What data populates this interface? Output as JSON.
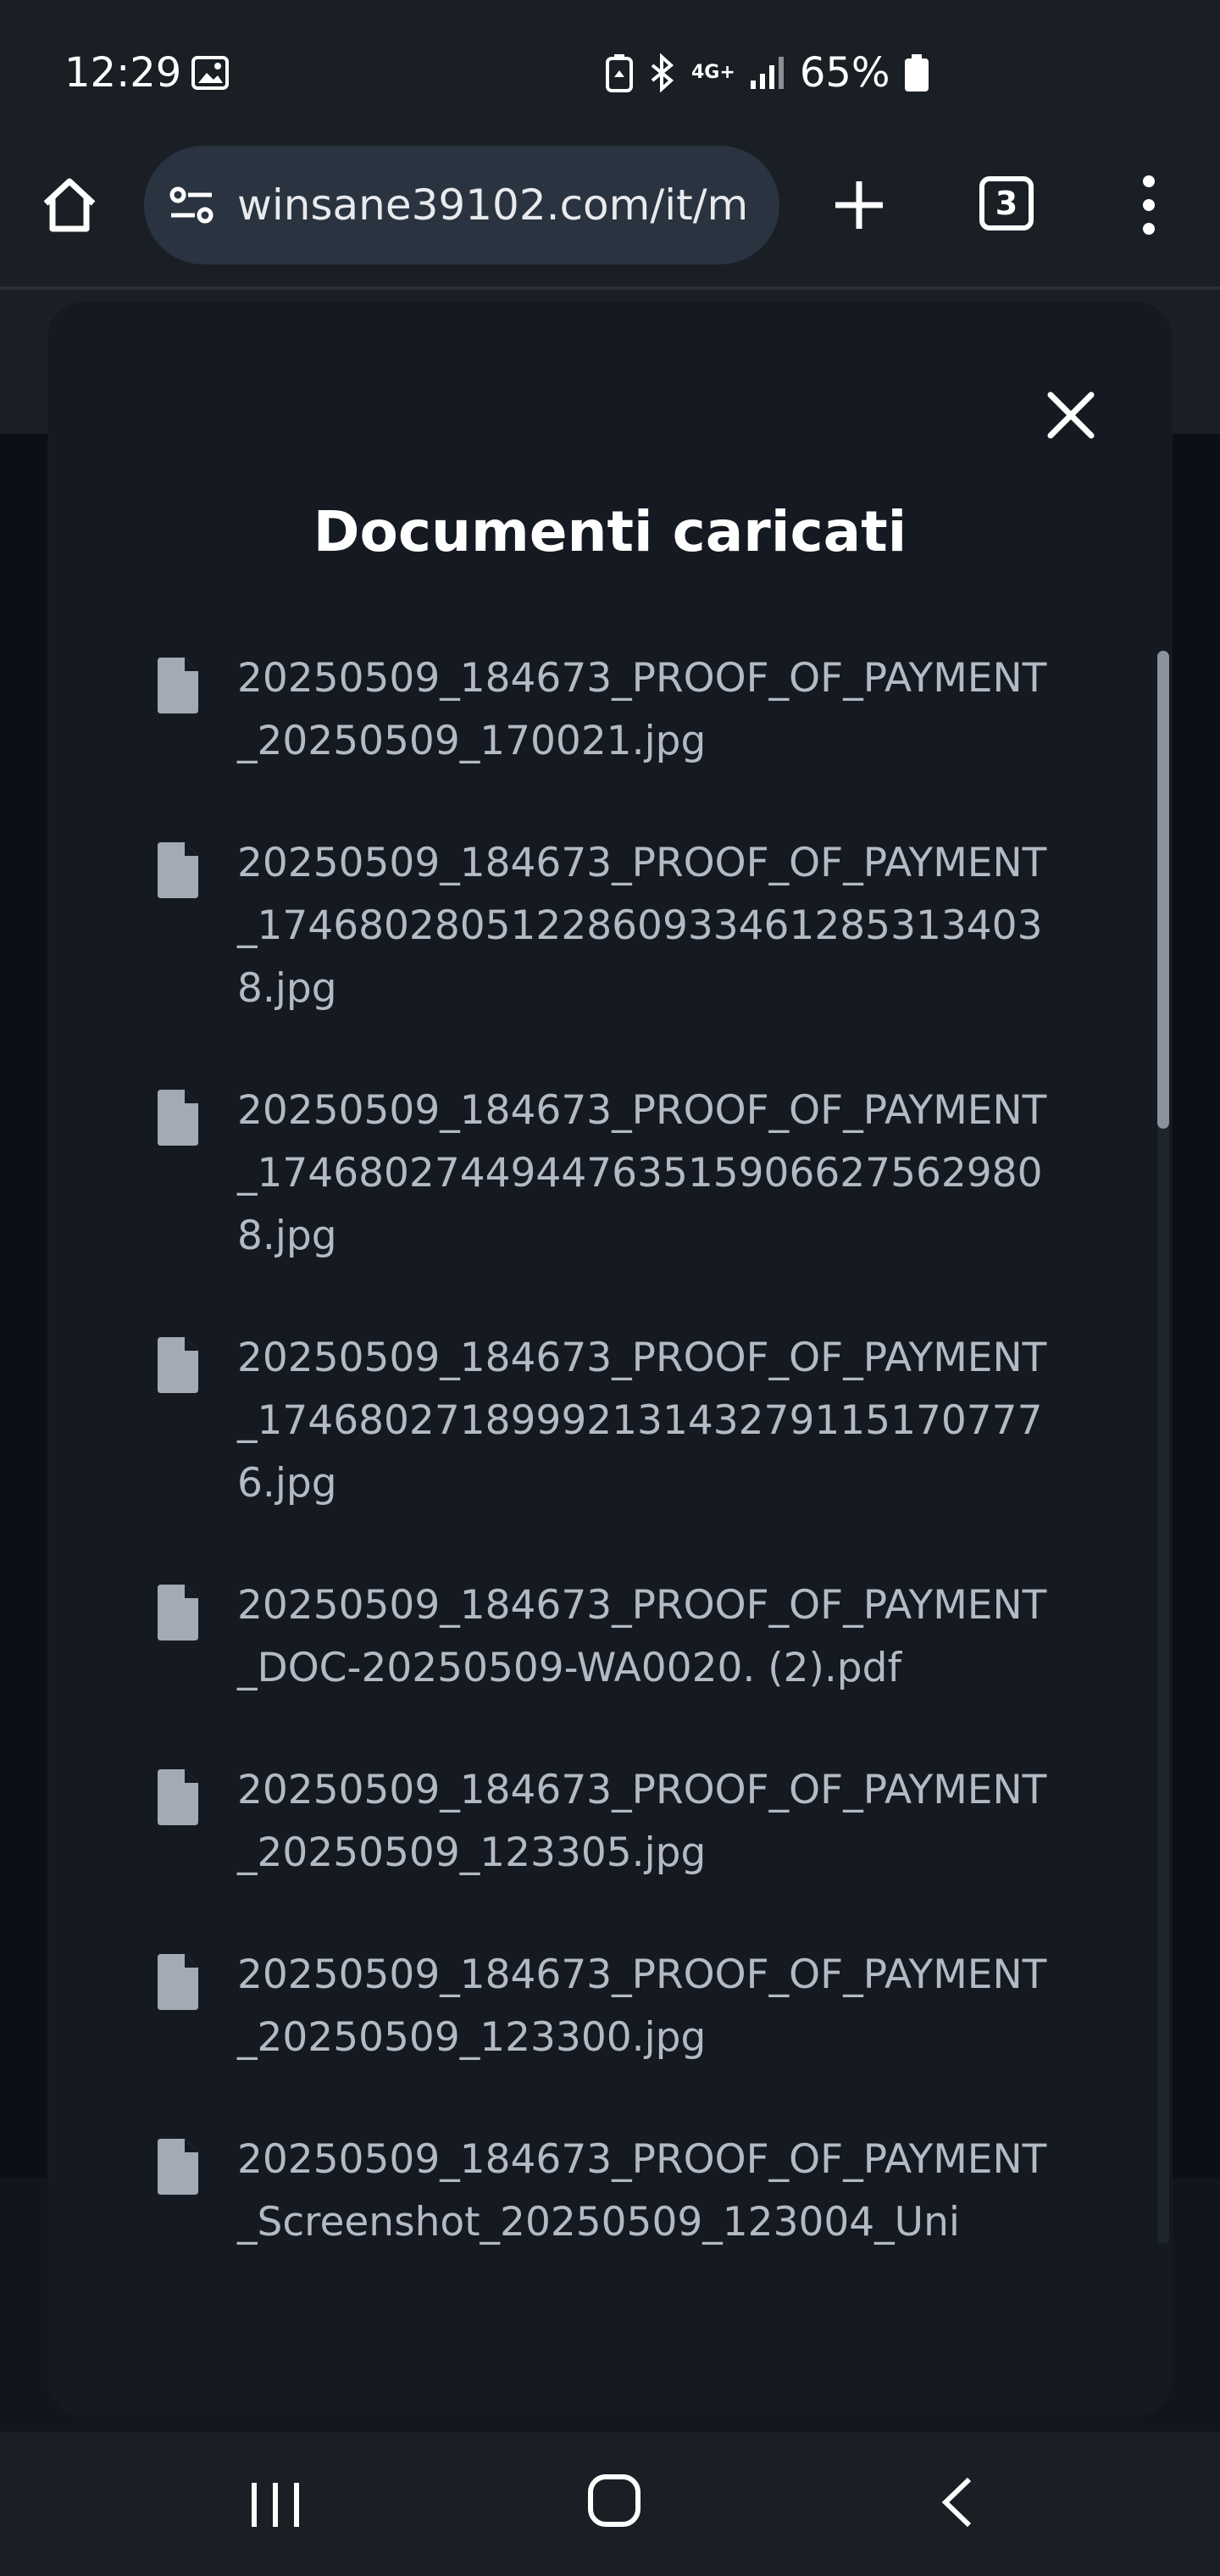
{
  "status": {
    "time": "12:29",
    "battery": "65%",
    "network": "4G+"
  },
  "browser": {
    "url": "winsane39102.com/it/m",
    "tab_count": "3"
  },
  "modal": {
    "title": "Documenti caricati",
    "documents": [
      "20250509_184673_PROOF_OF_PAYMENT_20250509_170021.jpg",
      "20250509_184673_PROOF_OF_PAYMENT_1746802805122860933461285313403 8.jpg",
      "20250509_184673_PROOF_OF_PAYMENT_17468027449447635159066275629808.jpg",
      "20250509_184673_PROOF_OF_PAYMENT_17468027189992131432791151707776.jpg",
      "20250509_184673_PROOF_OF_PAYMENT_DOC-20250509-WA0020. (2).pdf",
      "20250509_184673_PROOF_OF_PAYMENT_20250509_123305.jpg",
      "20250509_184673_PROOF_OF_PAYMENT_20250509_123300.jpg",
      "20250509_184673_PROOF_OF_PAYMENT_Screenshot_20250509_123004_Uni"
    ],
    "scroll_position": 0.0,
    "scroll_visible_fraction": 0.3
  },
  "colors": {
    "modal_bg": "#151a22",
    "text_muted": "#b4bac4",
    "icon_gray": "#a3aab3"
  }
}
